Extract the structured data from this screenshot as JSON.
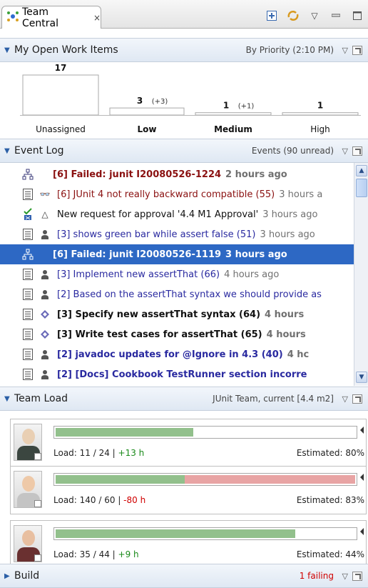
{
  "view": {
    "title": "Team Central",
    "close_glyph": "×",
    "tools": [
      "new-item-icon",
      "sync-icon",
      "view-menu-icon",
      "minimize-icon",
      "maximize-icon"
    ]
  },
  "work_items": {
    "title": "My Open Work Items",
    "summary": "By Priority (2:10 PM)",
    "chart_data": {
      "type": "bar",
      "categories": [
        "Unassigned",
        "Low",
        "Medium",
        "High"
      ],
      "values": [
        17,
        3,
        1,
        1
      ],
      "value_labels": [
        "17",
        "3",
        "1",
        "1"
      ],
      "change_labels": [
        "",
        "(+3)",
        "(+1)",
        ""
      ],
      "bold_categories": [
        "Low",
        "Medium"
      ]
    }
  },
  "event_log": {
    "title": "Event Log",
    "summary": "Events (90 unread)",
    "rows": [
      {
        "icon1": "build-icon",
        "icon2": "",
        "text": "[6] Failed: junit I20080526-1224",
        "ago": "2 hours ago",
        "bold": true,
        "red": true,
        "selected": false
      },
      {
        "icon1": "task-icon",
        "icon2": "binoculars-icon",
        "text": "[6] JUnit 4 not really backward compatible (55)",
        "ago": "3 hours a",
        "bold": false,
        "red": true,
        "selected": false
      },
      {
        "icon1": "approval-icon",
        "icon2": "triangle-icon",
        "text": "New request for approval '4.4 M1 Approval'",
        "ago": "3 hours ago",
        "bold": false,
        "red": false,
        "plain": true,
        "selected": false
      },
      {
        "icon1": "task-icon",
        "icon2": "person-icon",
        "text": "[3] shows green bar while assert false (51)",
        "ago": "3 hours ago",
        "bold": false,
        "red": false,
        "selected": false
      },
      {
        "icon1": "build-icon",
        "icon2": "",
        "text": "[6] Failed: junit I20080526-1119",
        "ago": "3 hours ago",
        "bold": true,
        "red": false,
        "selected": true
      },
      {
        "icon1": "task-icon",
        "icon2": "person-icon",
        "text": "[3] Implement new assertThat (66)",
        "ago": "4 hours ago",
        "bold": false,
        "red": false,
        "selected": false
      },
      {
        "icon1": "task-icon",
        "icon2": "person-icon",
        "text": "[2] Based on the assertThat syntax we should provide as",
        "ago": "",
        "bold": false,
        "red": false,
        "selected": false
      },
      {
        "icon1": "task-icon",
        "icon2": "diamond-icon",
        "text": "[3] Specify new assertThat syntax (64)",
        "ago": "4 hours",
        "bold": true,
        "red": false,
        "dark": true,
        "selected": false
      },
      {
        "icon1": "task-icon",
        "icon2": "diamond-icon",
        "text": "[3] Write test cases for assertThat (65)",
        "ago": "4 hours",
        "bold": true,
        "red": false,
        "dark": true,
        "selected": false
      },
      {
        "icon1": "task-icon",
        "icon2": "person-icon",
        "text": "[2] javadoc updates for @Ignore in 4.3 (40)",
        "ago": "4 hc",
        "bold": true,
        "red": false,
        "selected": false
      },
      {
        "icon1": "task-icon",
        "icon2": "person-icon",
        "text": "[2] [Docs] Cookbook TestRunner section incorre",
        "ago": "",
        "bold": true,
        "red": false,
        "selected": false
      }
    ]
  },
  "team_load": {
    "title": "Team Load",
    "summary": "JUnit Team, current [4.4 m2]",
    "members": [
      {
        "load": "Load: 11 / 24",
        "delta": "+13 h",
        "delta_positive": true,
        "estimated": "Estimated: 80%",
        "green_fraction": 0.46,
        "red_fraction": 0.0,
        "colors": {
          "skin": "#e9cfb3",
          "body": "#3b4640"
        }
      },
      {
        "load": "Load: 140 / 60",
        "delta": "-80 h",
        "delta_positive": false,
        "estimated": "Estimated: 83%",
        "green_fraction": 0.43,
        "red_fraction": 0.57,
        "colors": {
          "skin": "#eec9a8",
          "body": "#c4c4c4"
        }
      },
      {
        "load": "Load: 35 / 44",
        "delta": "+9 h",
        "delta_positive": true,
        "estimated": "Estimated: 44%",
        "green_fraction": 0.8,
        "red_fraction": 0.0,
        "colors": {
          "skin": "#e8bfa0",
          "body": "#6a3030"
        }
      }
    ]
  },
  "build": {
    "title": "Build",
    "summary": "1 failing"
  }
}
